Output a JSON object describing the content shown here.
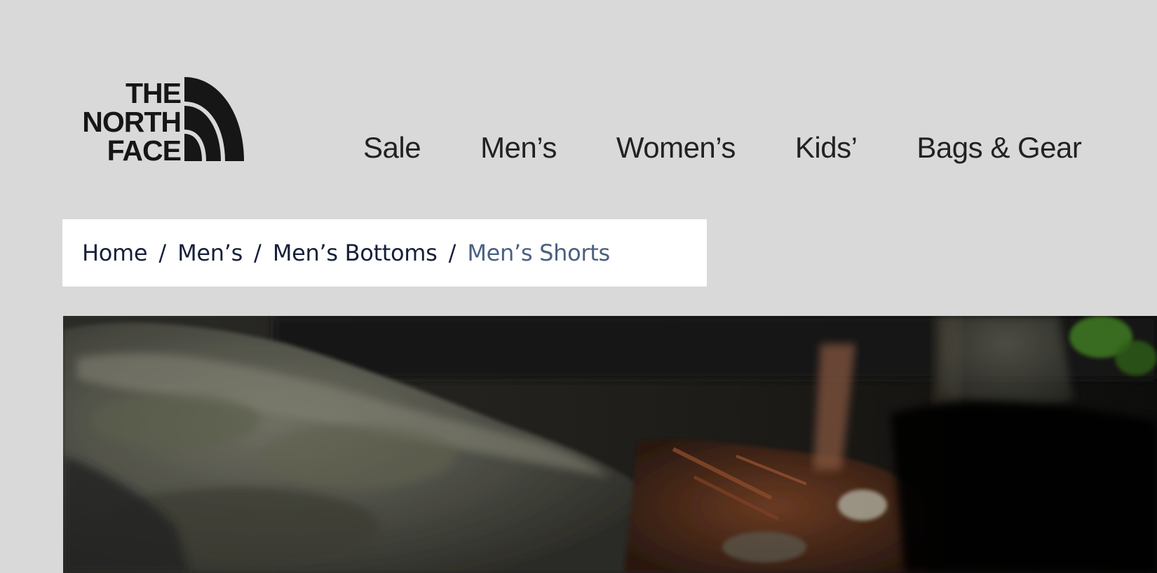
{
  "brand": {
    "name": "The North Face",
    "logo_lines": [
      "THE",
      "NORTH",
      "FACE"
    ],
    "logo_color": "#161616"
  },
  "nav": {
    "items": [
      {
        "label": "Sale"
      },
      {
        "label": "Men’s"
      },
      {
        "label": "Women’s"
      },
      {
        "label": "Kids’"
      },
      {
        "label": "Bags & Gear"
      }
    ]
  },
  "breadcrumb": {
    "separator": "/",
    "items": [
      {
        "label": "Home"
      },
      {
        "label": "Men’s"
      },
      {
        "label": "Men’s Bottoms"
      }
    ],
    "current": "Men’s Shorts",
    "link_color": "#152039",
    "current_color": "#4b6080"
  },
  "hero": {
    "icon": "forest-rock-trail-image"
  },
  "colors": {
    "page_background": "#d9d9d9",
    "nav_text": "#222222",
    "breadcrumb_background": "#ffffff"
  }
}
